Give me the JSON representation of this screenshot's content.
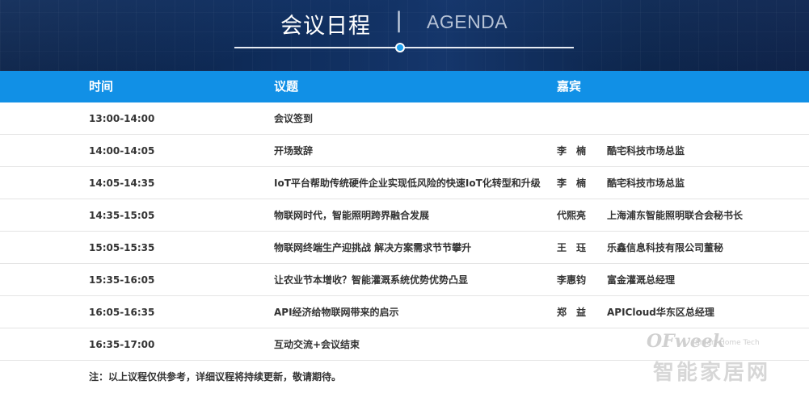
{
  "header": {
    "title_cn": "会议日程",
    "separator": "|",
    "title_en": "AGENDA",
    "accent_color": "#1190e6"
  },
  "table": {
    "columns": [
      "时间",
      "议题",
      "嘉宾"
    ],
    "rows": [
      {
        "time": "13:00-14:00",
        "topic": "会议签到",
        "name": "",
        "title": ""
      },
      {
        "time": "14:00-14:05",
        "topic": "开场致辞",
        "name": "李　楠",
        "title": "酷宅科技市场总监"
      },
      {
        "time": "14:05-14:35",
        "topic": "IoT平台帮助传统硬件企业实现低风险的快速IoT化转型和升级",
        "name": "李　楠",
        "title": "酷宅科技市场总监"
      },
      {
        "time": "14:35-15:05",
        "topic": "物联网时代，智能照明跨界融合发展",
        "name": "代熙亮",
        "title": "上海浦东智能照明联合会秘书长"
      },
      {
        "time": "15:05-15:35",
        "topic": "物联网终端生产迎挑战 解决方案需求节节攀升",
        "name": "王　珏",
        "title": "乐鑫信息科技有限公司董秘"
      },
      {
        "time": "15:35-16:05",
        "topic": "让农业节本增收？智能灌溉系统优势优势凸显",
        "name": "李惠钧",
        "title": "富金灌溉总经理"
      },
      {
        "time": "16:05-16:35",
        "topic": "API经济给物联网带来的启示",
        "name": "郑　益",
        "title": "APICloud华东区总经理"
      },
      {
        "time": "16:35-17:00",
        "topic": "互动交流+会议结束",
        "name": "",
        "title": ""
      }
    ]
  },
  "note": "注：以上议程仅供参考，详细议程将持续更新，敬请期待。",
  "watermark": {
    "logo": "OFweek",
    "sub": "Smart Home Tech",
    "text": "智能家居网"
  }
}
